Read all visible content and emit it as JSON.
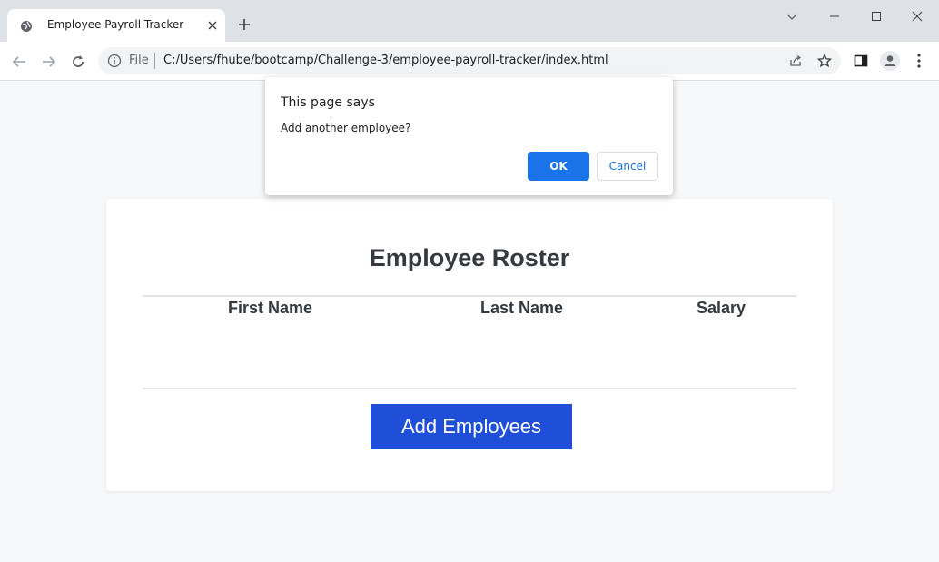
{
  "browser": {
    "tab_title": "Employee Payroll Tracker",
    "file_label": "File",
    "url": "C:/Users/fhube/bootcamp/Challenge-3/employee-payroll-tracker/index.html"
  },
  "dialog": {
    "title": "This page says",
    "message": "Add another employee?",
    "ok_label": "OK",
    "cancel_label": "Cancel"
  },
  "roster": {
    "title": "Employee Roster",
    "columns": [
      "First Name",
      "Last Name",
      "Salary"
    ],
    "rows": [],
    "add_button_label": "Add Employees"
  },
  "colors": {
    "accent": "#1a73e8",
    "add_button": "#1f4fd8"
  }
}
